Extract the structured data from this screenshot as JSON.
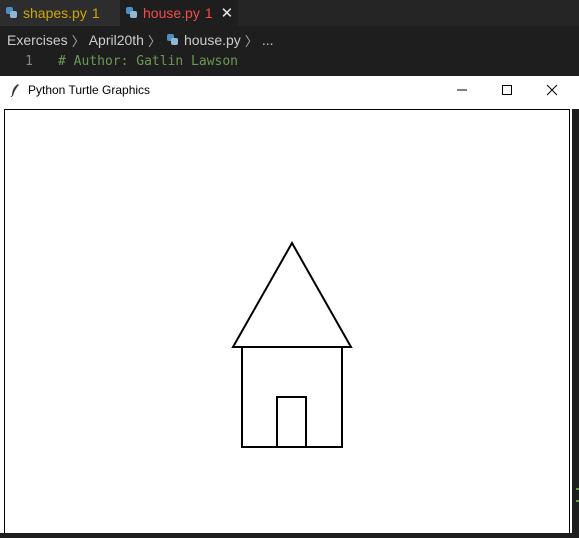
{
  "editor": {
    "tabs": [
      {
        "name": "shapes.py",
        "count": "1"
      },
      {
        "name": "house.py",
        "count": "1",
        "close": "✕"
      }
    ],
    "breadcrumbs": [
      "Exercises",
      "April20th",
      "house.py",
      "..."
    ],
    "code": {
      "line_number": "1",
      "text": "# Author: Gatlin Lawson"
    }
  },
  "turtle_window": {
    "title": "Python Turtle Graphics",
    "pen_color": "#000000",
    "background": "#ffffff"
  }
}
